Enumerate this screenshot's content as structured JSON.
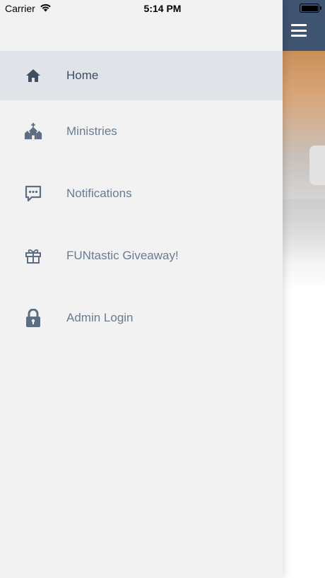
{
  "status_bar": {
    "carrier": "Carrier",
    "time": "5:14 PM",
    "icons": [
      "wifi-icon",
      "battery-icon"
    ]
  },
  "app_bar": {
    "menu_icon": "hamburger-menu-icon",
    "color": "#3f5470"
  },
  "drawer": {
    "items": [
      {
        "label": "Home",
        "icon": "home-icon",
        "active": true
      },
      {
        "label": "Ministries",
        "icon": "church-icon",
        "active": false
      },
      {
        "label": "Notifications",
        "icon": "chat-bubble-icon",
        "active": false
      },
      {
        "label": "FUNtastic Giveaway!",
        "icon": "gift-icon",
        "active": false
      },
      {
        "label": "Admin Login",
        "icon": "lock-icon",
        "active": false
      }
    ]
  },
  "colors": {
    "icon": "#5d6d82",
    "active_icon": "#3e4e63",
    "active_background": "#e0e3e8",
    "drawer_background": "#f2f2f2"
  }
}
